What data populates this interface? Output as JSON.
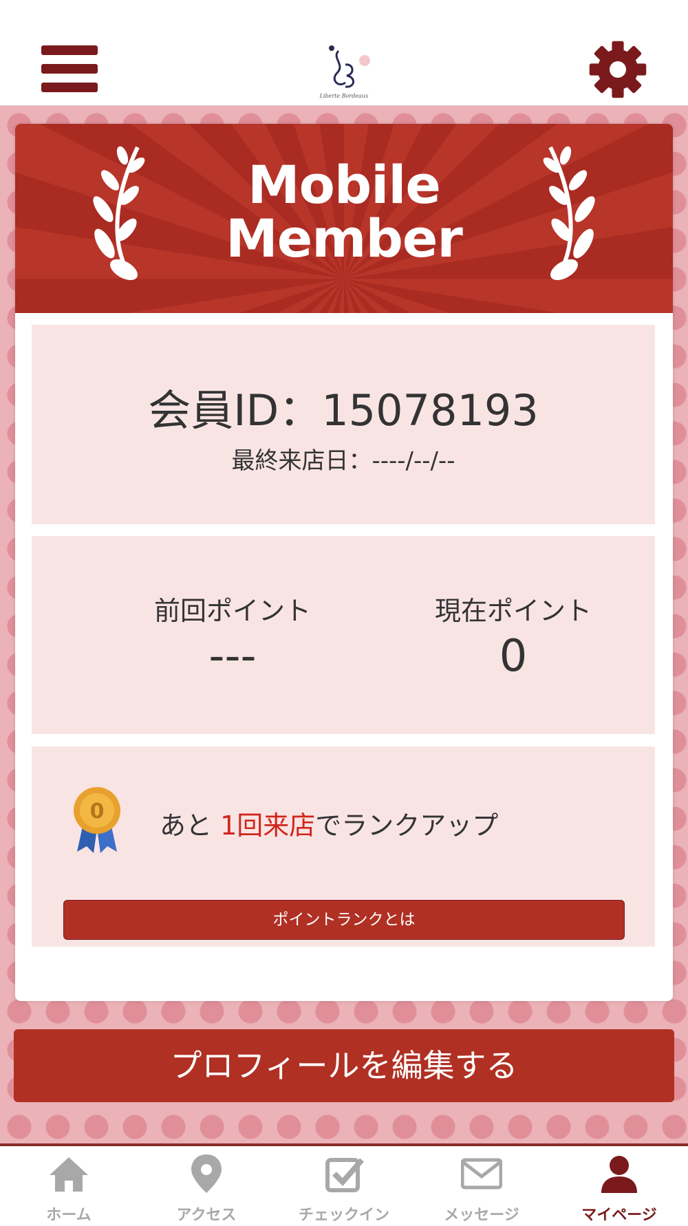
{
  "header": {
    "menu_icon": "hamburger-menu-icon",
    "logo_alt": "Liberte Bordeaux",
    "settings_icon": "gear-icon"
  },
  "banner": {
    "title_line1": "Mobile",
    "title_line2": "Member"
  },
  "member": {
    "id_text": "会員ID：15078193",
    "last_visit_text": "最終来店日：----/--/--"
  },
  "points": {
    "previous_label": "前回ポイント",
    "previous_value": "---",
    "current_label": "現在ポイント",
    "current_value": "0"
  },
  "rank": {
    "prefix": "あと ",
    "highlight": "1回来店",
    "suffix": "でランクアップ",
    "button_label": "ポイントランクとは",
    "medal_number": "0"
  },
  "edit_profile_label": "プロフィールを編集する",
  "tabs": [
    {
      "label": "ホーム",
      "icon": "home-icon",
      "active": false
    },
    {
      "label": "アクセス",
      "icon": "map-pin-icon",
      "active": false
    },
    {
      "label": "チェックイン",
      "icon": "checkbox-icon",
      "active": false
    },
    {
      "label": "メッセージ",
      "icon": "envelope-icon",
      "active": false
    },
    {
      "label": "マイページ",
      "icon": "user-icon",
      "active": true
    }
  ],
  "colors": {
    "brand_red": "#b03024",
    "dark_red": "#7a1a1c",
    "panel_pink": "#f9e4e4",
    "highlight_red": "#d0261c"
  }
}
